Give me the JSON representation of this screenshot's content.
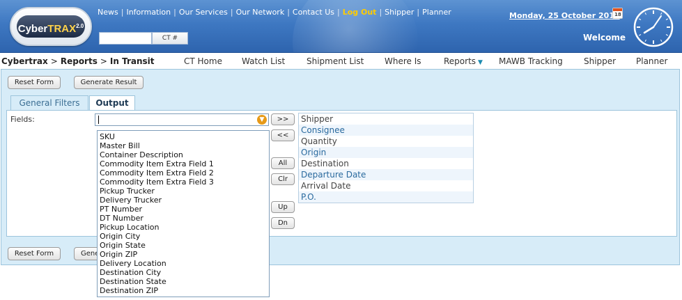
{
  "header": {
    "logo": {
      "brand_start": "Cyber",
      "brand_end": "TRAX",
      "version": "2.0"
    },
    "top_links": [
      {
        "label": "News"
      },
      {
        "label": "Information"
      },
      {
        "label": "Our Services"
      },
      {
        "label": "Our Network"
      },
      {
        "label": "Contact Us"
      },
      {
        "label": "Log Out",
        "highlight": true
      },
      {
        "label": "Shipper"
      },
      {
        "label": "Planner"
      }
    ],
    "ct_search": {
      "value": "",
      "button_label": "CT #"
    },
    "date": "Monday, 25 October 2010",
    "calendar_day": "18",
    "welcome": "Welcome",
    "colors": {
      "header_blue": "#3e78c2",
      "logout": "#ffcc00"
    }
  },
  "breadcrumb": {
    "items": [
      "Cybertrax",
      "Reports",
      "In Transit"
    ],
    "separator": ">"
  },
  "nav": [
    {
      "label": "CT Home"
    },
    {
      "label": "Watch List"
    },
    {
      "label": "Shipment List"
    },
    {
      "label": "Where Is"
    },
    {
      "label": "Reports",
      "has_dropdown": true
    },
    {
      "label": "MAWB Tracking"
    },
    {
      "label": "Shipper"
    },
    {
      "label": "Planner"
    }
  ],
  "form": {
    "reset_label": "Reset Form",
    "generate_label": "Generate Result",
    "bottom_generate_visible": "Gene",
    "tabs": [
      {
        "label": "General Filters",
        "active": false
      },
      {
        "label": "Output",
        "active": true
      }
    ],
    "fields_label": "Fields:",
    "fields_value": "",
    "buttons": {
      "add": ">>",
      "remove": "<<",
      "all": "All",
      "clear": "Clr",
      "up": "Up",
      "down": "Dn"
    },
    "selected_fields": [
      "Shipper",
      "Consignee",
      "Quantity",
      "Origin",
      "Destination",
      "Departure Date",
      "Arrival Date",
      "P.O."
    ],
    "dropdown_options": [
      "SKU",
      "Master Bill",
      "Container Description",
      "Commodity Item Extra Field 1",
      "Commodity Item Extra Field 2",
      "Commodity Item Extra Field 3",
      "Pickup Trucker",
      "Delivery Trucker",
      "PT Number",
      "DT Number",
      "Pickup Location",
      "Origin City",
      "Origin State",
      "Origin ZIP",
      "Delivery Location",
      "Destination City",
      "Destination State",
      "Destination ZIP"
    ],
    "colors": {
      "panel_bg": "#d7ecf8",
      "select_arrow": "#e79a18"
    }
  }
}
